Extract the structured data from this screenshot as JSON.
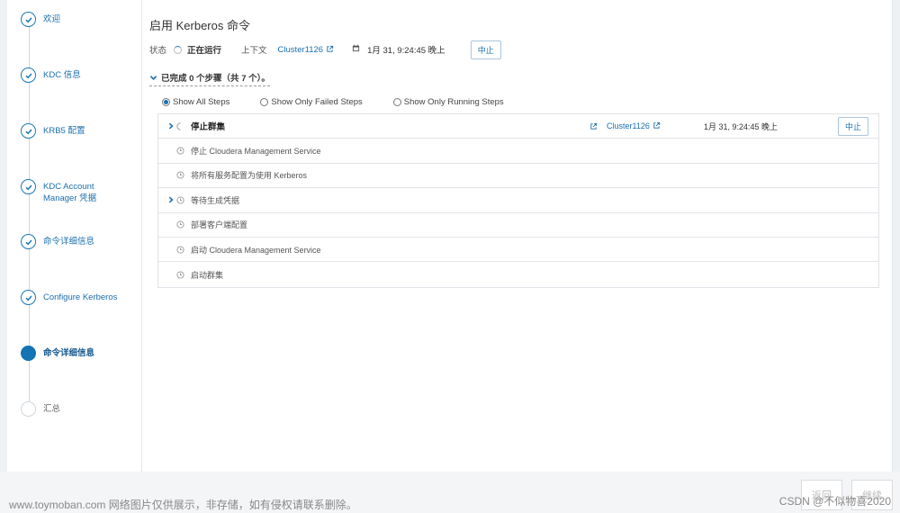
{
  "wizard_steps": [
    {
      "label": "欢迎",
      "state": "done"
    },
    {
      "label": "KDC 信息",
      "state": "done"
    },
    {
      "label": "KRB5 配置",
      "state": "done"
    },
    {
      "label": "KDC Account Manager 凭据",
      "state": "done"
    },
    {
      "label": "命令详细信息",
      "state": "done"
    },
    {
      "label": "Configure Kerberos",
      "state": "done"
    },
    {
      "label": "命令详细信息",
      "state": "active"
    },
    {
      "label": "汇总",
      "state": "pending"
    }
  ],
  "page_title": "启用 Kerberos 命令",
  "status": {
    "status_label": "状态",
    "status_value": "正在运行",
    "context_label": "上下文",
    "context_value": "Cluster1126",
    "time": "1月 31, 9:24:45 晚上",
    "abort_label": "中止"
  },
  "progress_text": "已完成 0 个步骤（共 7 个）。",
  "filters": [
    {
      "label": "Show All Steps",
      "selected": true
    },
    {
      "label": "Show Only Failed Steps",
      "selected": false
    },
    {
      "label": "Show Only Running Steps",
      "selected": false
    }
  ],
  "steps_table": {
    "head": {
      "label": "停止群集",
      "context": "Cluster1126",
      "time": "1月 31, 9:24:45 晚上",
      "abort_label": "中止"
    },
    "rows": [
      {
        "label": "停止 Cloudera Management Service",
        "expandable": false
      },
      {
        "label": "将所有服务配置为使用 Kerberos",
        "expandable": false
      },
      {
        "label": "等待生成凭据",
        "expandable": true
      },
      {
        "label": "部署客户端配置",
        "expandable": false
      },
      {
        "label": "启动 Cloudera Management Service",
        "expandable": false
      },
      {
        "label": "启动群集",
        "expandable": false
      }
    ]
  },
  "footer": {
    "back_label": "返回",
    "continue_label": "继续"
  },
  "watermark": "www.toymoban.com 网络图片仅供展示，非存储，如有侵权请联系删除。",
  "csdn_credit": "CSDN @不似物喜2020",
  "colors": {
    "accent": "#1473b3",
    "link": "#1b6fae"
  }
}
